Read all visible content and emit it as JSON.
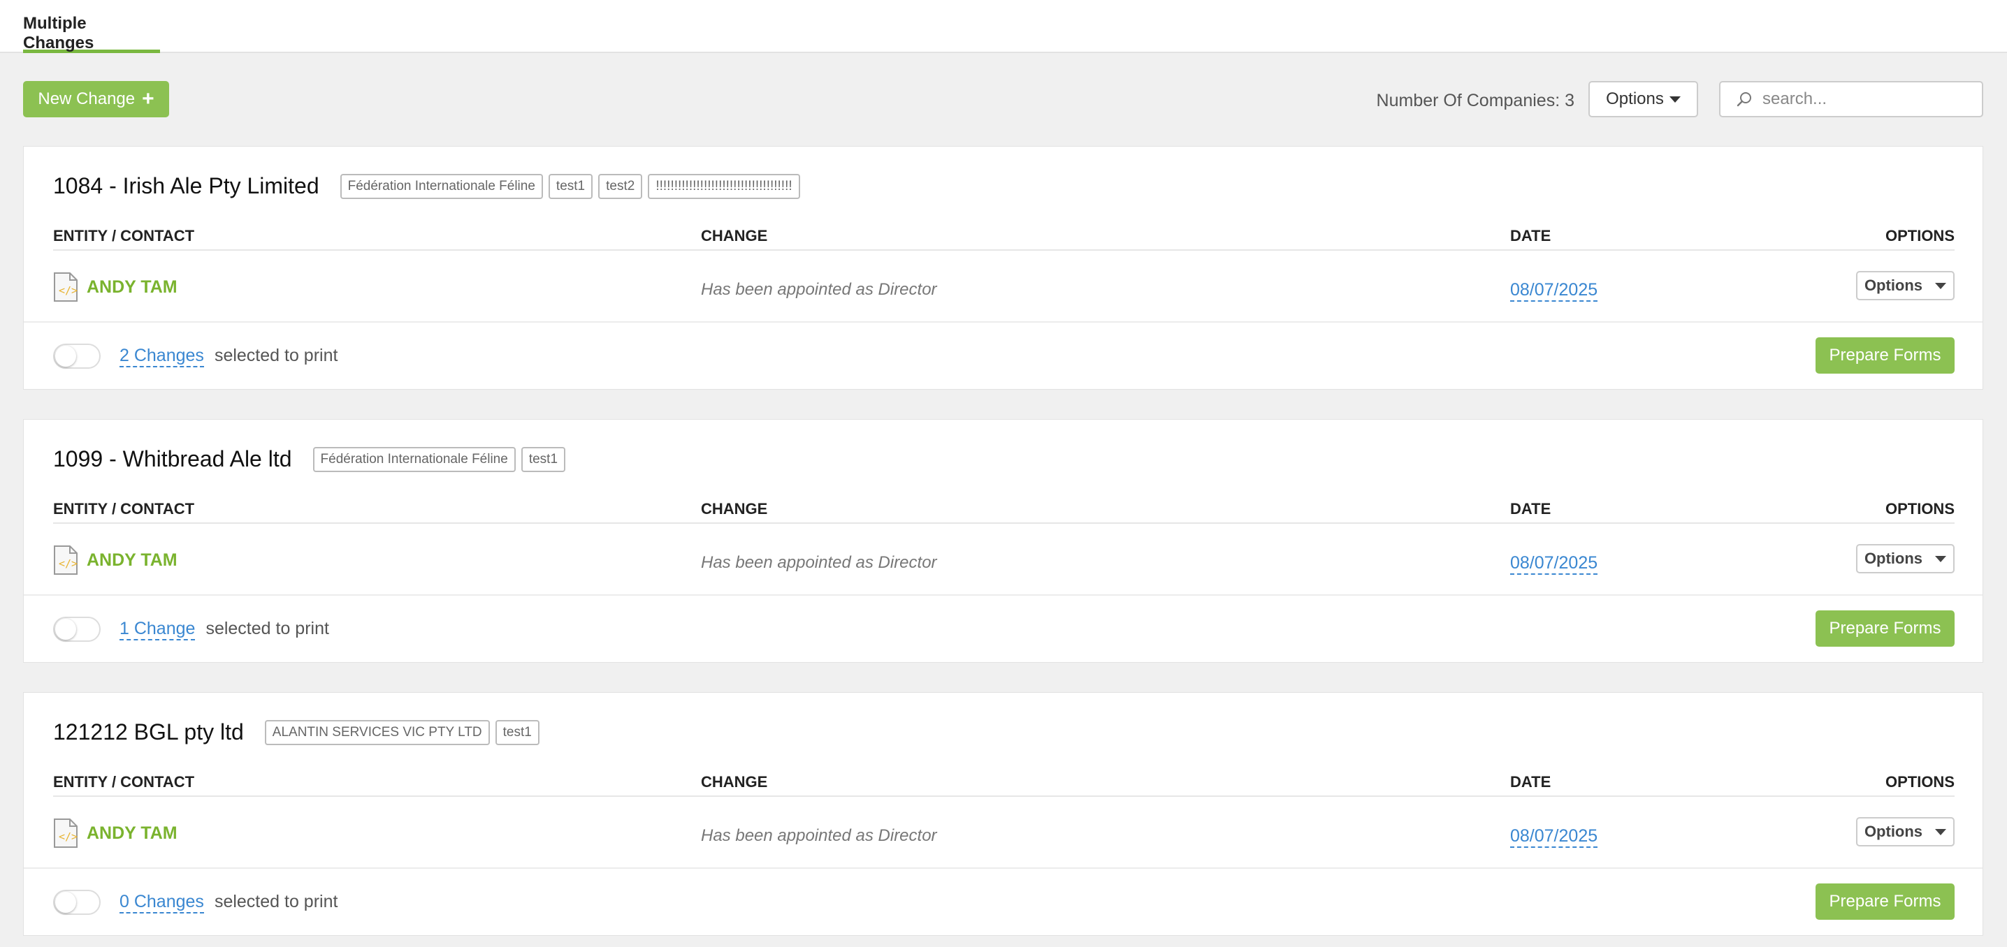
{
  "header": {
    "tab_label": "Multiple Changes"
  },
  "toolbar": {
    "new_change_label": "New Change",
    "number_of_companies_label": "Number Of Companies: 3",
    "options_label": "Options",
    "search_placeholder": "search..."
  },
  "table_headers": {
    "entity": "ENTITY / CONTACT",
    "change": "CHANGE",
    "date": "DATE",
    "options": "OPTIONS"
  },
  "companies": [
    {
      "name": "1084 - Irish Ale Pty Limited",
      "tags": [
        "Fédération Internationale Féline",
        "test1",
        "test2",
        "!!!!!!!!!!!!!!!!!!!!!!!!!!!!!!!!!!!!!"
      ],
      "entity": "ANDY TAM",
      "change": "Has been appointed as Director",
      "date": "08/07/2025",
      "options_label": "Options",
      "changes_link": "2 Changes",
      "selected_text": "selected to print",
      "prepare_label": "Prepare Forms"
    },
    {
      "name": "1099 - Whitbread Ale ltd",
      "tags": [
        "Fédération Internationale Féline",
        "test1"
      ],
      "entity": "ANDY TAM",
      "change": "Has been appointed as Director",
      "date": "08/07/2025",
      "options_label": "Options",
      "changes_link": "1 Change",
      "selected_text": "selected to print",
      "prepare_label": "Prepare Forms"
    },
    {
      "name": "121212 BGL pty ltd",
      "tags": [
        "ALANTIN SERVICES VIC PTY LTD",
        "test1"
      ],
      "entity": "ANDY TAM",
      "change": "Has been appointed as Director",
      "date": "08/07/2025",
      "options_label": "Options",
      "changes_link": "0 Changes",
      "selected_text": "selected to print",
      "prepare_label": "Prepare Forms"
    }
  ],
  "colors": {
    "accent_green": "#8cc152",
    "link_blue": "#3a87d1",
    "entity_green": "#7ab32e"
  }
}
